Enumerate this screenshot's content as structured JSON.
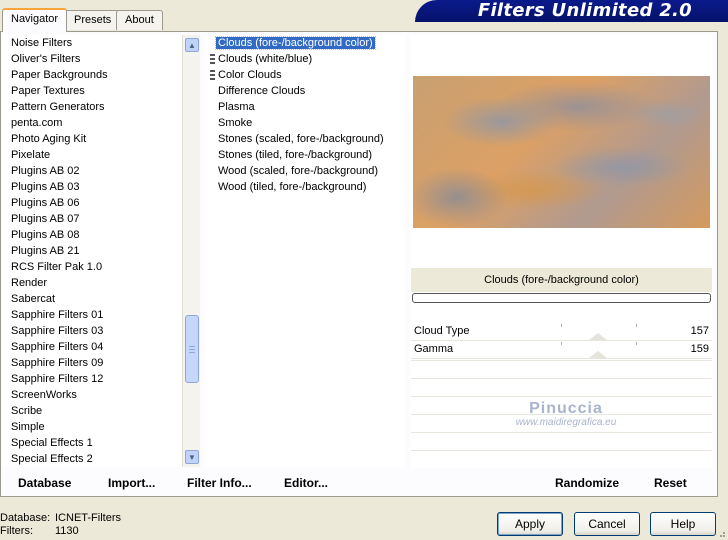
{
  "tabs": [
    "Navigator",
    "Presets",
    "About"
  ],
  "banner_title": "Filters Unlimited 2.0",
  "categories": [
    "Noise Filters",
    "Oliver's Filters",
    "Paper Backgrounds",
    "Paper Textures",
    "Pattern Generators",
    "penta.com",
    "Photo Aging Kit",
    "Pixelate",
    "Plugins AB 02",
    "Plugins AB 03",
    "Plugins AB 06",
    "Plugins AB 07",
    "Plugins AB 08",
    "Plugins AB 21",
    "RCS Filter Pak 1.0",
    "Render",
    "Sabercat",
    "Sapphire Filters 01",
    "Sapphire Filters 03",
    "Sapphire Filters 04",
    "Sapphire Filters 09",
    "Sapphire Filters 12",
    "ScreenWorks",
    "Scribe",
    "Simple",
    "Special Effects 1",
    "Special Effects 2"
  ],
  "filters": [
    "Clouds (fore-/background color)",
    "Clouds (white/blue)",
    "Color Clouds",
    "Difference Clouds",
    "Plasma",
    "Smoke",
    "Stones (scaled, fore-/background)",
    "Stones (tiled, fore-/background)",
    "Wood (scaled, fore-/background)",
    "Wood (tiled, fore-/background)"
  ],
  "selected_filter_name": "Clouds (fore-/background color)",
  "params": [
    {
      "label": "Cloud Type",
      "value": "157"
    },
    {
      "label": "Gamma",
      "value": "159"
    }
  ],
  "watermark": {
    "name": "Pinuccia",
    "url": "www.maidiregrafica.eu"
  },
  "actions": {
    "database": "Database",
    "import": "Import...",
    "filter_info": "Filter Info...",
    "editor": "Editor...",
    "randomize": "Randomize",
    "reset": "Reset"
  },
  "status": {
    "database_label": "Database:",
    "database_value": "ICNET-Filters",
    "filters_label": "Filters:",
    "filters_value": "1130"
  },
  "buttons": {
    "apply": "Apply",
    "cancel": "Cancel",
    "help": "Help"
  },
  "colors": {
    "accent": "#316ac5",
    "banner": "#0b1a8c"
  }
}
